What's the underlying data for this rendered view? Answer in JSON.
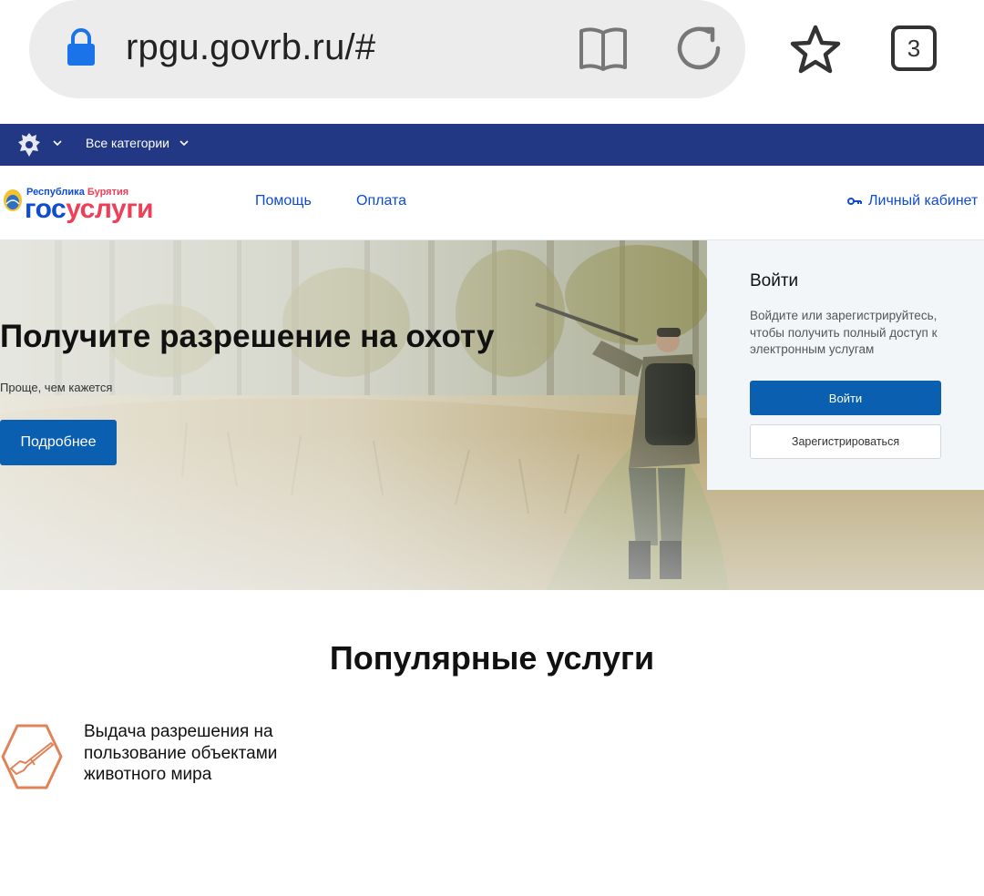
{
  "browser": {
    "url": "rpgu.govrb.ru/#",
    "tab_count": "3",
    "icons": [
      "lock-icon",
      "reader-mode-icon",
      "reload-icon",
      "star-icon",
      "tabs-icon"
    ]
  },
  "top_strip": {
    "categories_label": "Все категории",
    "background_color": "#233884"
  },
  "header": {
    "logo": {
      "region_prefix": "Республика ",
      "region_name": "Бурятия",
      "brand_part1": "гос",
      "brand_part2": "услуги"
    },
    "nav": {
      "help": "Помощь",
      "payment": "Оплата",
      "cabinet": "Личный кабинет"
    }
  },
  "hero": {
    "title": "Получите разрешение на охоту",
    "subtitle": "Проще, чем кажется",
    "button_label": "Подробнее"
  },
  "login": {
    "title": "Войти",
    "description": "Войдите или зарегистрируйтесь, чтобы получить полный доступ к электронным услугам",
    "login_button": "Войти",
    "register_button": "Зарегистрироваться"
  },
  "popular": {
    "title": "Популярные услуги",
    "services": [
      {
        "label": "Выдача разрешения на пользование объектами животного мира",
        "icon": "rifle-icon"
      }
    ]
  },
  "colors": {
    "primary_blue": "#0a5fb0",
    "brand_blue": "#0d4cd3",
    "brand_red": "#ee3f58",
    "service_icon": "#e0835a"
  }
}
